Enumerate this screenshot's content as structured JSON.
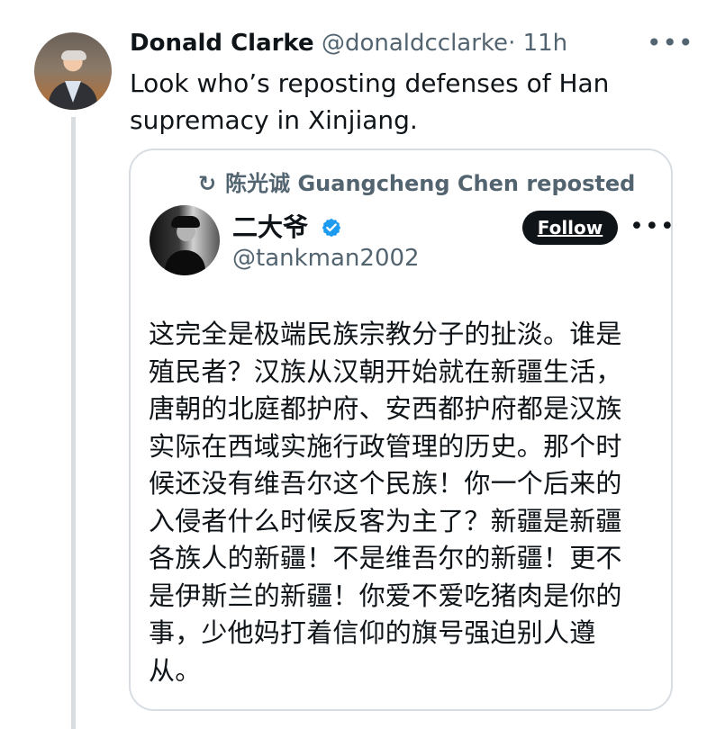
{
  "author": {
    "display_name": "Donald Clarke",
    "handle": "@donaldcclarke",
    "time": "· 11h"
  },
  "tweet": {
    "text_line1": "Look who’s reposting defenses of Han",
    "text_line2": "supremacy in Xinjiang."
  },
  "quote": {
    "repost_text": "陈光诚 Guangcheng Chen reposted",
    "display_name": "二大爷",
    "handle": "@tankman2002",
    "follow_label": "Follow",
    "lines": [
      "这完全是极端民族宗教分子的扯淡。谁是",
      "殖民者？汉族从汉朝开始就在新疆生活，",
      "唐朝的北庭都护府、安西都护府都是汉族",
      "实际在西域实施行政管理的历史。那个时",
      "候还没有维吾尔这个民族！你一个后来的",
      "入侵者什么时候反客为主了？新疆是新疆",
      "各族人的新疆！不是维吾尔的新疆！更不",
      "是伊斯兰的新疆！你爱不爱吃猪肉是你的",
      "事，少他妈打着信仰的旗号强迫别人遵",
      "从。"
    ]
  },
  "icons": {
    "repost": "repost-icon",
    "verified": "verified-badge-icon",
    "more": "more-options-icon"
  },
  "glyphs": {
    "more": "•••",
    "repost": "↻"
  },
  "colors": {
    "text_primary": "#0f1419",
    "text_secondary": "#536471",
    "border": "#d7dde2",
    "verified_blue": "#1d9bf0",
    "follow_background": "#0f1419"
  }
}
